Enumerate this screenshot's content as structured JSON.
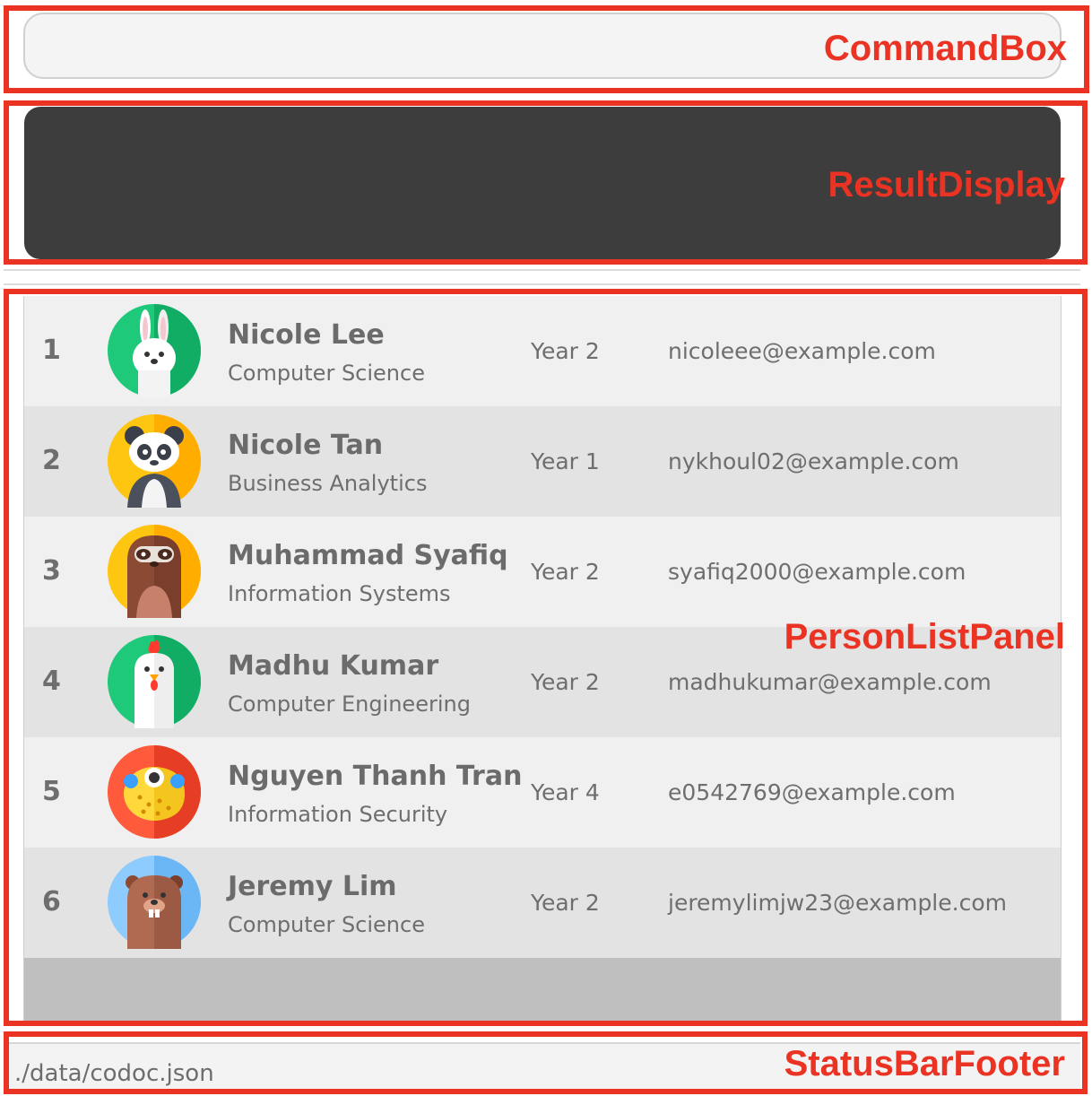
{
  "command_box": {
    "value": "",
    "annotation": "CommandBox"
  },
  "result_display": {
    "text": "",
    "annotation": "ResultDisplay"
  },
  "person_list": {
    "annotation": "PersonListPanel",
    "persons": [
      {
        "index": "1",
        "name": "Nicole Lee",
        "major": "Computer Science",
        "year": "Year 2",
        "email": "nicoleee@example.com",
        "avatar": "rabbit-icon"
      },
      {
        "index": "2",
        "name": "Nicole Tan",
        "major": "Business Analytics",
        "year": "Year 1",
        "email": "nykhoul02@example.com",
        "avatar": "panda-icon"
      },
      {
        "index": "3",
        "name": "Muhammad Syafiq",
        "major": "Information Systems",
        "year": "Year 2",
        "email": "syafiq2000@example.com",
        "avatar": "sloth-icon"
      },
      {
        "index": "4",
        "name": "Madhu Kumar",
        "major": "Computer Engineering",
        "year": "Year 2",
        "email": "madhukumar@example.com",
        "avatar": "chicken-icon"
      },
      {
        "index": "5",
        "name": "Nguyen Thanh Tran",
        "major": "Information Security",
        "year": "Year 4",
        "email": "e0542769@example.com",
        "avatar": "pufferfish-icon"
      },
      {
        "index": "6",
        "name": "Jeremy Lim",
        "major": "Computer Science",
        "year": "Year 2",
        "email": "jeremylimjw23@example.com",
        "avatar": "beaver-icon"
      }
    ]
  },
  "status_bar": {
    "path": "./data/codoc.json",
    "annotation": "StatusBarFooter"
  },
  "colors": {
    "annotation_red": "#ea3323",
    "result_bg": "#3d3d3d",
    "row_light": "#f0f0f0",
    "row_dark": "#e3e3e3",
    "list_empty": "#bfbfbf"
  }
}
